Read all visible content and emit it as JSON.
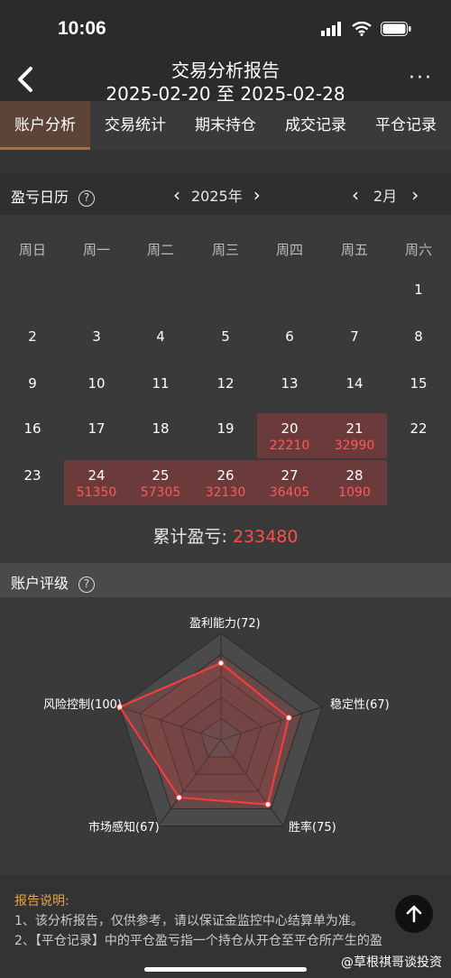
{
  "status": {
    "time": "10:06"
  },
  "header": {
    "title": "交易分析报告",
    "date_range": "2025-02-20 至 2025-02-28",
    "more": "···"
  },
  "tabs": [
    {
      "label": "账户分析",
      "active": true
    },
    {
      "label": "交易统计"
    },
    {
      "label": "期末持仓"
    },
    {
      "label": "成交记录"
    },
    {
      "label": "平仓记录"
    }
  ],
  "calendar": {
    "title": "盈亏日历",
    "year": "2025年",
    "month": "2月",
    "weekdays": [
      "周日",
      "周一",
      "周二",
      "周三",
      "周四",
      "周五",
      "周六"
    ],
    "weeks": [
      [
        {
          "d": ""
        },
        {
          "d": ""
        },
        {
          "d": ""
        },
        {
          "d": ""
        },
        {
          "d": ""
        },
        {
          "d": ""
        },
        {
          "d": "1"
        }
      ],
      [
        {
          "d": "2"
        },
        {
          "d": "3"
        },
        {
          "d": "4"
        },
        {
          "d": "5"
        },
        {
          "d": "6"
        },
        {
          "d": "7"
        },
        {
          "d": "8"
        }
      ],
      [
        {
          "d": "9"
        },
        {
          "d": "10"
        },
        {
          "d": "11"
        },
        {
          "d": "12"
        },
        {
          "d": "13"
        },
        {
          "d": "14"
        },
        {
          "d": "15"
        }
      ],
      [
        {
          "d": "16"
        },
        {
          "d": "17"
        },
        {
          "d": "18"
        },
        {
          "d": "19"
        },
        {
          "d": "20",
          "v": "22210"
        },
        {
          "d": "21",
          "v": "32990"
        },
        {
          "d": "22"
        }
      ],
      [
        {
          "d": "23"
        },
        {
          "d": "24",
          "v": "51350"
        },
        {
          "d": "25",
          "v": "57305"
        },
        {
          "d": "26",
          "v": "32130"
        },
        {
          "d": "27",
          "v": "36405"
        },
        {
          "d": "28",
          "v": "1090"
        },
        {
          "d": ""
        }
      ]
    ],
    "cumulative_label": "累计盈亏:",
    "cumulative_value": "233480"
  },
  "rating": {
    "title": "账户评级",
    "axes": [
      {
        "label": "盈利能力(72)",
        "value": 72
      },
      {
        "label": "稳定性(67)",
        "value": 67
      },
      {
        "label": "胜率(75)",
        "value": 75
      },
      {
        "label": "市场感知(67)",
        "value": 67
      },
      {
        "label": "风险控制(100)",
        "value": 100
      }
    ],
    "max": 100
  },
  "notes": {
    "title": "报告说明:",
    "lines": [
      "1、该分析报告，仅供参考，请以保证金监控中心结算单为准。",
      "2、【平仓记录】中的平仓盈亏指一个持仓从开仓至平仓所产生的盈"
    ]
  },
  "watermark": "@草根祺哥谈投资",
  "colors": {
    "profit": "#ff4d4d",
    "accent": "#b66b3a",
    "notes_title": "#e6a44a"
  }
}
